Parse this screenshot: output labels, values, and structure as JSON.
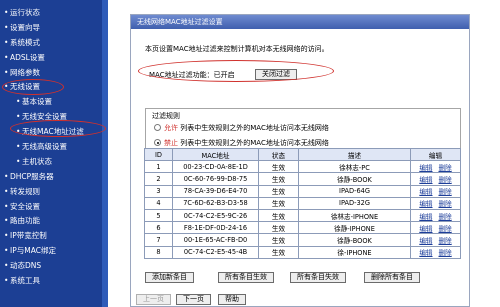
{
  "sidebar": {
    "items": [
      {
        "label": "运行状态",
        "sub": false
      },
      {
        "label": "设置向导",
        "sub": false
      },
      {
        "label": "系统模式",
        "sub": false
      },
      {
        "label": "ADSL设置",
        "sub": false
      },
      {
        "label": "网络参数",
        "sub": false
      },
      {
        "label": "无线设置",
        "sub": false,
        "circled": true
      },
      {
        "label": "基本设置",
        "sub": true
      },
      {
        "label": "无线安全设置",
        "sub": true
      },
      {
        "label": "无线MAC地址过滤",
        "sub": true,
        "circled": true
      },
      {
        "label": "无线高级设置",
        "sub": true
      },
      {
        "label": "主机状态",
        "sub": true
      },
      {
        "label": "DHCP服务器",
        "sub": false
      },
      {
        "label": "转发规则",
        "sub": false
      },
      {
        "label": "安全设置",
        "sub": false
      },
      {
        "label": "路由功能",
        "sub": false
      },
      {
        "label": "IP带宽控制",
        "sub": false
      },
      {
        "label": "IP与MAC绑定",
        "sub": false
      },
      {
        "label": "动态DNS",
        "sub": false
      },
      {
        "label": "系统工具",
        "sub": false
      }
    ]
  },
  "panel": {
    "title": "无线网络MAC地址过滤设置",
    "intro": "本页设置MAC地址过滤来控制计算机对本无线网络的访问。",
    "status_label": "MAC地址过滤功能：",
    "status_value": "已开启",
    "close_button": "关闭过滤"
  },
  "rules": {
    "title": "过滤规则",
    "options": [
      {
        "keyword": "允许",
        "text": "列表中生效规则之外的MAC地址访问本无线网络",
        "selected": false
      },
      {
        "keyword": "禁止",
        "text": "列表中生效规则之外的MAC地址访问本无线网络",
        "selected": true
      }
    ]
  },
  "table": {
    "headers": [
      "ID",
      "MAC地址",
      "状态",
      "描述",
      "编辑"
    ],
    "edit_label": "编辑",
    "delete_label": "删除",
    "rows": [
      {
        "id": "1",
        "mac": "00-23-CD-0A-8E-1D",
        "status": "生效",
        "desc": "徐林志-PC"
      },
      {
        "id": "2",
        "mac": "0C-60-76-99-D8-75",
        "status": "生效",
        "desc": "徐静-BOOK"
      },
      {
        "id": "3",
        "mac": "78-CA-39-D6-E4-70",
        "status": "生效",
        "desc": "IPAD-64G"
      },
      {
        "id": "4",
        "mac": "7C-6D-62-B3-D3-58",
        "status": "生效",
        "desc": "IPAD-32G"
      },
      {
        "id": "5",
        "mac": "0C-74-C2-E5-9C-26",
        "status": "生效",
        "desc": "徐林志-IPHONE"
      },
      {
        "id": "6",
        "mac": "F8-1E-DF-0D-24-16",
        "status": "生效",
        "desc": "徐静-IPHONE"
      },
      {
        "id": "7",
        "mac": "00-1E-65-AC-FB-D0",
        "status": "生效",
        "desc": "徐静-BOOK"
      },
      {
        "id": "8",
        "mac": "0C-74-C2-E5-45-4B",
        "status": "生效",
        "desc": "徐-IPHONE"
      }
    ]
  },
  "actions": {
    "add": "添加新条目",
    "enable_all": "所有条目生效",
    "disable_all": "所有条目失效",
    "delete_all": "删除所有条目"
  },
  "pager": {
    "prev": "上一页",
    "next": "下一页",
    "help": "帮助"
  }
}
